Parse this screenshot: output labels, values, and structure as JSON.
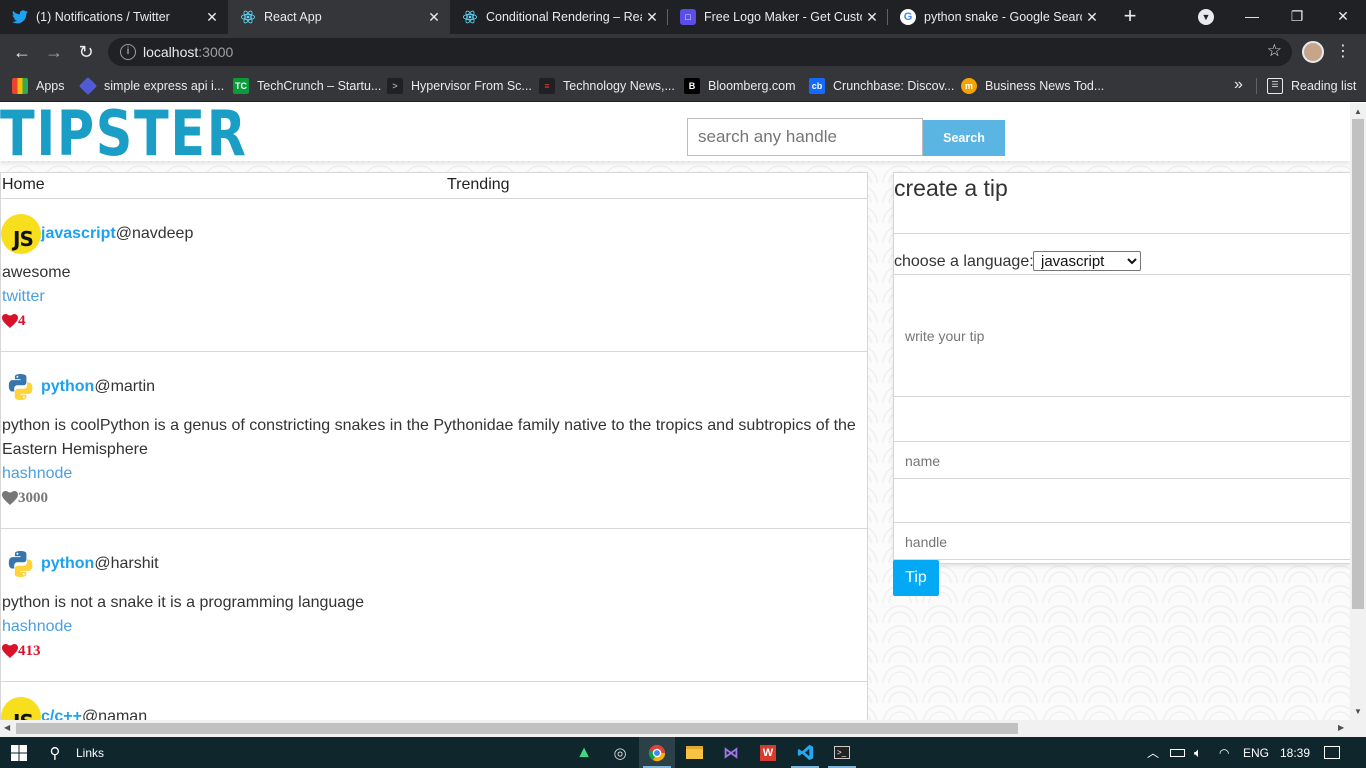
{
  "browser": {
    "tabs": [
      {
        "title": "(1) Notifications / Twitter",
        "icon": "twitter-icon",
        "active": false
      },
      {
        "title": "React App",
        "icon": "react-icon",
        "active": true
      },
      {
        "title": "Conditional Rendering – Reac",
        "icon": "react-icon",
        "active": false
      },
      {
        "title": "Free Logo Maker - Get Custo",
        "icon": "logo-maker-icon",
        "active": false
      },
      {
        "title": "python snake - Google Searc",
        "icon": "google-icon",
        "active": false
      }
    ],
    "url_host": "localhost",
    "url_port": ":3000",
    "bookmarks": [
      {
        "label": "Apps",
        "icon": "apps-grid-icon"
      },
      {
        "label": "simple express api i...",
        "icon": "diamond-icon"
      },
      {
        "label": "TechCrunch – Startu...",
        "icon": "techcrunch-icon"
      },
      {
        "label": "Hypervisor From Sc...",
        "icon": "terminal-icon"
      },
      {
        "label": "Technology News,...",
        "icon": "news-icon"
      },
      {
        "label": "Bloomberg.com",
        "icon": "bloomberg-icon"
      },
      {
        "label": "Crunchbase: Discov...",
        "icon": "crunchbase-icon"
      },
      {
        "label": "Business News Tod...",
        "icon": "business-news-icon"
      }
    ],
    "reading_list": "Reading list"
  },
  "site": {
    "logo": "TIPSTER",
    "search_placeholder": "search any handle",
    "search_button": "Search"
  },
  "feed": {
    "nav": {
      "home": "Home",
      "trending": "Trending"
    },
    "tips": [
      {
        "language": "javascript",
        "handle": "@navdeep",
        "text": "awesome",
        "source": "twitter",
        "likes": "4",
        "liked": true
      },
      {
        "language": "python",
        "handle": "@martin",
        "text": "python is coolPython is a genus of constricting snakes in the Pythonidae family native to the tropics and subtropics of the Eastern Hemisphere",
        "source": "hashnode",
        "likes": "3000",
        "liked": false
      },
      {
        "language": "python",
        "handle": "@harshit",
        "text": "python is not a snake it is a programming language",
        "source": "hashnode",
        "likes": "413",
        "liked": true
      },
      {
        "language": "c/c++",
        "handle": "@naman",
        "text": "",
        "source": "",
        "likes": "",
        "liked": false
      }
    ]
  },
  "create_tip": {
    "heading": "create a tip",
    "language_label": "choose a language:",
    "language_selected": "javascript",
    "tip_placeholder": "write your tip",
    "name_placeholder": "name",
    "handle_placeholder": "handle",
    "submit": "Tip"
  },
  "taskbar": {
    "search_label": "Links",
    "language": "ENG",
    "time": "18:39"
  },
  "colors": {
    "brand": "#1b9ec6",
    "search_button": "#5bb5e2",
    "tip_button": "#03a9f4",
    "like_red": "#d9122a",
    "link_blue": "#1da1f2"
  }
}
